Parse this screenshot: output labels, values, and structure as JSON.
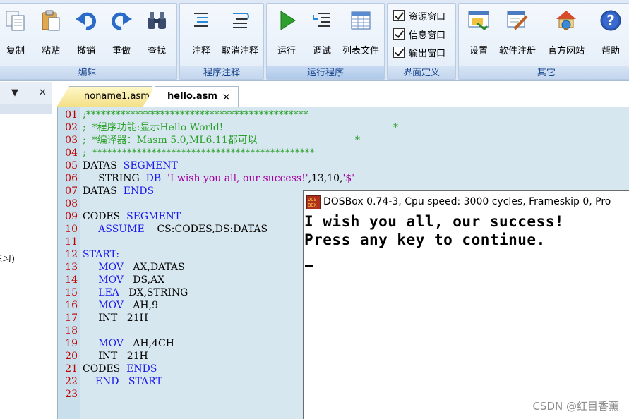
{
  "ribbon": {
    "groups": [
      {
        "label": "编辑",
        "buttons": [
          {
            "label": "复制"
          },
          {
            "label": "粘贴"
          },
          {
            "label": "撤销"
          },
          {
            "label": "重做"
          },
          {
            "label": "查找"
          }
        ]
      },
      {
        "label": "程序注释",
        "buttons": [
          {
            "label": "注释"
          },
          {
            "label": "取消注释"
          }
        ]
      },
      {
        "label": "运行程序",
        "buttons": [
          {
            "label": "运行"
          },
          {
            "label": "调试"
          },
          {
            "label": "列表文件"
          }
        ]
      },
      {
        "label": "界面定义",
        "checkboxes": [
          {
            "label": "资源窗口",
            "checked": true
          },
          {
            "label": "信息窗口",
            "checked": true
          },
          {
            "label": "输出窗口",
            "checked": true
          }
        ]
      },
      {
        "label": "其它",
        "buttons": [
          {
            "label": "设置"
          },
          {
            "label": "软件注册"
          },
          {
            "label": "官方网站"
          },
          {
            "label": "帮助"
          }
        ]
      }
    ]
  },
  "left_panel": {
    "pin_icon": "pin-icon",
    "close_icon": "close-icon",
    "clipped_text": "练习)"
  },
  "tabs": [
    {
      "label": "noname1.asm",
      "active": false
    },
    {
      "label": "hello.asm",
      "active": true,
      "close": "×"
    }
  ],
  "editor": {
    "line_numbers": [
      "01",
      "02",
      "03",
      "04",
      "05",
      "06",
      "07",
      "08",
      "09",
      "10",
      "11",
      "12",
      "13",
      "14",
      "15",
      "16",
      "17",
      "18",
      "19",
      "20",
      "21",
      "22",
      "23"
    ],
    "lines": {
      "l01": ";*********************************************",
      "l02a": ";  *程序功能:显示Hello World!",
      "l02b": "*",
      "l03a": ";  *编译器：Masm 5.0,ML6.11都可以",
      "l03b": "*",
      "l04": ";  *********************************************",
      "l05a": "DATAS  ",
      "l05b": "SEGMENT",
      "l06a": "     STRING  ",
      "l06b": "DB",
      "l06c": "  'I wish you all, our success!'",
      "l06d": ",13,10,",
      "l06e": "'$'",
      "l07a": "DATAS  ",
      "l07b": "ENDS",
      "l09a": "CODES  ",
      "l09b": "SEGMENT",
      "l10a": "     ",
      "l10b": "ASSUME",
      "l10c": "    CS:CODES,DS:DATAS",
      "l12": "START:",
      "l13a": "     ",
      "l13b": "MOV",
      "l13c": "   AX,DATAS",
      "l14a": "     ",
      "l14b": "MOV",
      "l14c": "   DS,AX",
      "l15a": "     ",
      "l15b": "LEA",
      "l15c": "   DX,STRING",
      "l16a": "     ",
      "l16b": "MOV",
      "l16c": "   AH,9",
      "l17a": "     ",
      "l17b": "INT",
      "l17c": "   21H",
      "l19a": "     ",
      "l19b": "MOV",
      "l19c": "   AH,4CH",
      "l20a": "     ",
      "l20b": "INT",
      "l20c": "   21H",
      "l21a": "CODES  ",
      "l21b": "ENDS",
      "l22a": "    ",
      "l22b": "END",
      "l22c": "   ",
      "l22d": "START"
    }
  },
  "dosbox": {
    "title": "DOSBox 0.74-3, Cpu speed:     3000 cycles, Frameskip  0, Pro",
    "output": [
      "I wish you all, our success!",
      "Press any key to continue."
    ]
  },
  "watermark": "CSDN @红目香薰",
  "colors": {
    "comment": "#2aa02a",
    "keyword": "#1a1aee",
    "string": "#a000a0",
    "line_number": "#c00000",
    "editor_bg": "#d7e7ef"
  }
}
